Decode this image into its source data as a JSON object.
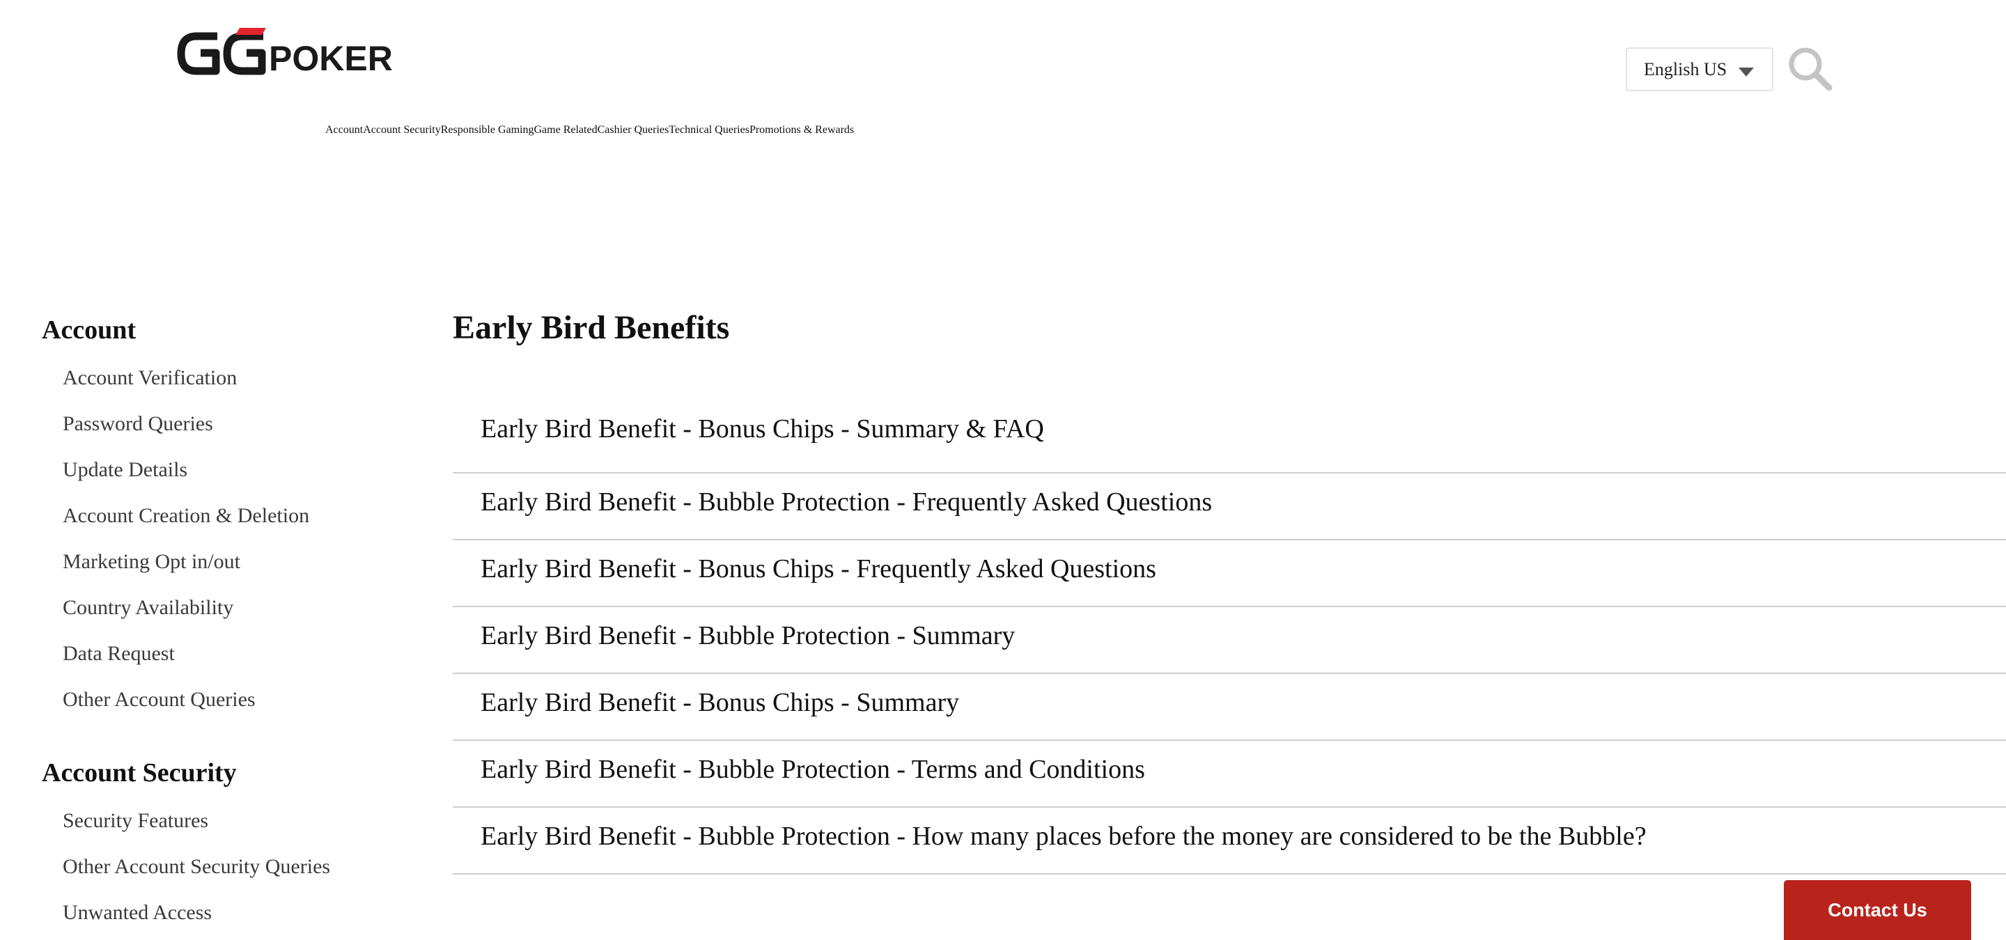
{
  "brand": {
    "logo_text": "GGPOKER",
    "logo_suffix": "POKER",
    "accent_color": "#e3262b",
    "dark_color": "#1a1a1a"
  },
  "header": {
    "language": {
      "selected": "English US",
      "icon": "chevron-down-icon"
    },
    "search_icon": "search-icon"
  },
  "topnav": {
    "items": [
      {
        "label": "Account"
      },
      {
        "label": "Account Security"
      },
      {
        "label": "Responsible Gaming"
      },
      {
        "label": "Game Related"
      },
      {
        "label": "Cashier Queries"
      },
      {
        "label": "Technical Queries"
      },
      {
        "label": "Promotions & Rewards"
      }
    ]
  },
  "sidebar": {
    "sections": [
      {
        "title": "Account",
        "items": [
          {
            "label": "Account Verification"
          },
          {
            "label": "Password Queries"
          },
          {
            "label": "Update Details"
          },
          {
            "label": "Account Creation & Deletion"
          },
          {
            "label": "Marketing Opt in/out"
          },
          {
            "label": "Country Availability"
          },
          {
            "label": "Data Request"
          },
          {
            "label": "Other Account Queries"
          }
        ]
      },
      {
        "title": "Account Security",
        "items": [
          {
            "label": "Security Features"
          },
          {
            "label": "Other Account Security Queries"
          },
          {
            "label": "Unwanted Access"
          }
        ]
      }
    ]
  },
  "main": {
    "title": "Early Bird Benefits",
    "articles": [
      {
        "title": "Early Bird Benefit - Bonus Chips - Summary & FAQ"
      },
      {
        "title": "Early Bird Benefit - Bubble Protection - Frequently Asked Questions"
      },
      {
        "title": "Early Bird Benefit - Bonus Chips - Frequently Asked Questions"
      },
      {
        "title": "Early Bird Benefit - Bubble Protection - Summary"
      },
      {
        "title": "Early Bird Benefit - Bonus Chips - Summary"
      },
      {
        "title": "Early Bird Benefit - Bubble Protection - Terms and Conditions"
      },
      {
        "title": "Early Bird Benefit - Bubble Protection - How many places before the money are considered to be the Bubble?"
      }
    ]
  },
  "contact": {
    "label": "Contact Us",
    "color": "#b8241c"
  }
}
